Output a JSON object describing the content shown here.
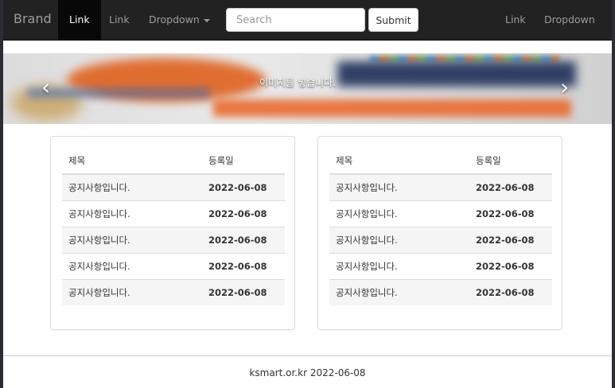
{
  "navbar": {
    "brand": "Brand",
    "links": [
      {
        "label": "Link"
      },
      {
        "label": "Link"
      },
      {
        "label": "Dropdown"
      }
    ],
    "search": {
      "placeholder": "Search",
      "value": ""
    },
    "submit_label": "Submit",
    "right_links": [
      {
        "label": "Link"
      },
      {
        "label": "Dropdown"
      }
    ]
  },
  "carousel": {
    "caption": "이미지를 넣습니다.",
    "prev_icon": "chevron-left-icon",
    "next_icon": "chevron-right-icon"
  },
  "panels": [
    {
      "headers": [
        "제목",
        "등록일"
      ],
      "rows": [
        [
          "공지사항입니다.",
          "2022-06-08"
        ],
        [
          "공지사항입니다.",
          "2022-06-08"
        ],
        [
          "공지사항입니다.",
          "2022-06-08"
        ],
        [
          "공지사항입니다.",
          "2022-06-08"
        ],
        [
          "공지사항입니다.",
          "2022-06-08"
        ]
      ]
    },
    {
      "headers": [
        "제목",
        "등록일"
      ],
      "rows": [
        [
          "공지사항입니다.",
          "2022-06-08"
        ],
        [
          "공지사항입니다.",
          "2022-06-08"
        ],
        [
          "공지사항입니다.",
          "2022-06-08"
        ],
        [
          "공지사항입니다.",
          "2022-06-08"
        ],
        [
          "공지사항입니다.",
          "2022-06-08"
        ]
      ]
    }
  ],
  "footer": {
    "text": "ksmart.or.kr 2022-06-08"
  },
  "colors": {
    "navbar_bg": "#222222",
    "active_link_bg": "#080808",
    "link_color": "#9d9d9d"
  }
}
